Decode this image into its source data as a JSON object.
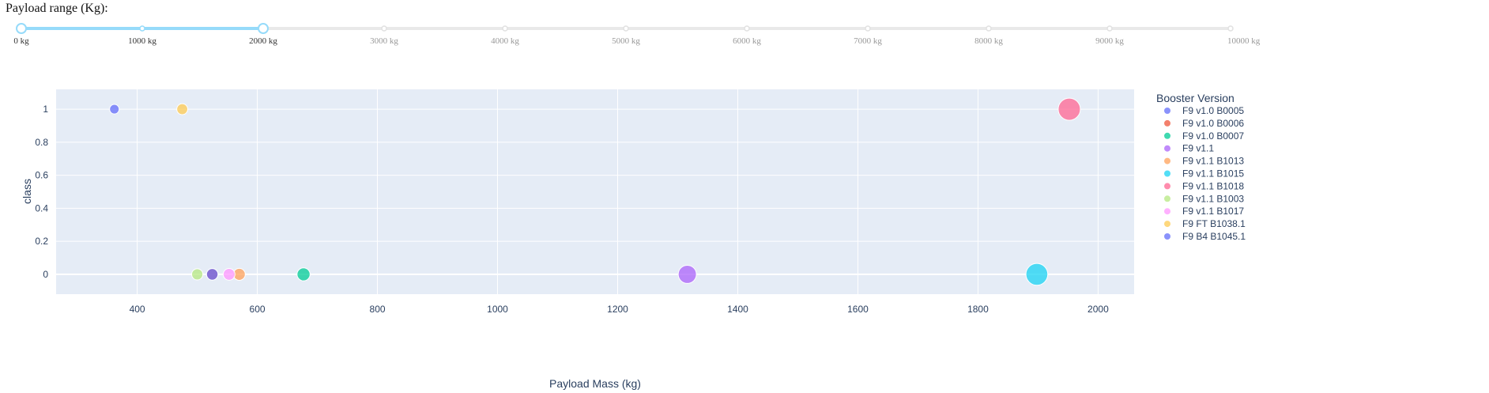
{
  "slider": {
    "label": "Payload range (Kg):",
    "min": 0,
    "max": 10000,
    "selected": [
      0,
      2000
    ],
    "marks": [
      "0 kg",
      "1000 kg",
      "2000 kg",
      "3000 kg",
      "4000 kg",
      "5000 kg",
      "6000 kg",
      "7000 kg",
      "8000 kg",
      "9000 kg",
      "10000 kg"
    ],
    "track_color": "#e9e9e9",
    "active_color": "#96dbfa",
    "handle_color": "#96dbfa"
  },
  "chart_data": {
    "type": "scatter",
    "xlabel": "Payload Mass (kg)",
    "ylabel": "class",
    "xlim": [
      265,
      2060
    ],
    "ylim": [
      -0.12,
      1.12
    ],
    "x_ticks": [
      400,
      600,
      800,
      1000,
      1200,
      1400,
      1600,
      1800,
      2000
    ],
    "y_ticks": [
      0,
      0.2,
      0.4,
      0.6,
      0.8,
      1
    ],
    "grid": true,
    "plot_background": "#e5ecf6",
    "legend_title": "Booster Version",
    "legend_position": "right",
    "series": [
      {
        "name": "F9 v1.0  B0005",
        "color": "#636efa",
        "points": [
          {
            "x": 362,
            "y": 1
          }
        ]
      },
      {
        "name": "F9 v1.0  B0006",
        "color": "#ef553b",
        "points": [
          {
            "x": 525,
            "y": 0
          }
        ]
      },
      {
        "name": "F9 v1.0  B0007",
        "color": "#00cc96",
        "points": [
          {
            "x": 677,
            "y": 0
          }
        ]
      },
      {
        "name": "F9 v1.1",
        "color": "#ab63fa",
        "points": [
          {
            "x": 1316,
            "y": 0
          }
        ]
      },
      {
        "name": "F9 v1.1 B1013",
        "color": "#ffa15a",
        "points": [
          {
            "x": 570,
            "y": 0
          }
        ]
      },
      {
        "name": "F9 v1.1 B1015",
        "color": "#19d3f3",
        "points": [
          {
            "x": 1898,
            "y": 0
          }
        ]
      },
      {
        "name": "F9 v1.1 B1018",
        "color": "#ff6692",
        "points": [
          {
            "x": 1952,
            "y": 1
          }
        ]
      },
      {
        "name": "F9 v1.1  B1003",
        "color": "#b6e880",
        "points": [
          {
            "x": 500,
            "y": 0
          }
        ]
      },
      {
        "name": "F9 v1.1 B1017",
        "color": "#ff97ff",
        "points": [
          {
            "x": 553,
            "y": 0
          }
        ]
      },
      {
        "name": "F9 FT B1038.1",
        "color": "#fecb52",
        "points": [
          {
            "x": 475,
            "y": 1
          }
        ]
      },
      {
        "name": "F9 B4 B1045.1",
        "color": "#636efa",
        "points": [
          {
            "x": 525,
            "y": 0
          }
        ]
      }
    ]
  }
}
